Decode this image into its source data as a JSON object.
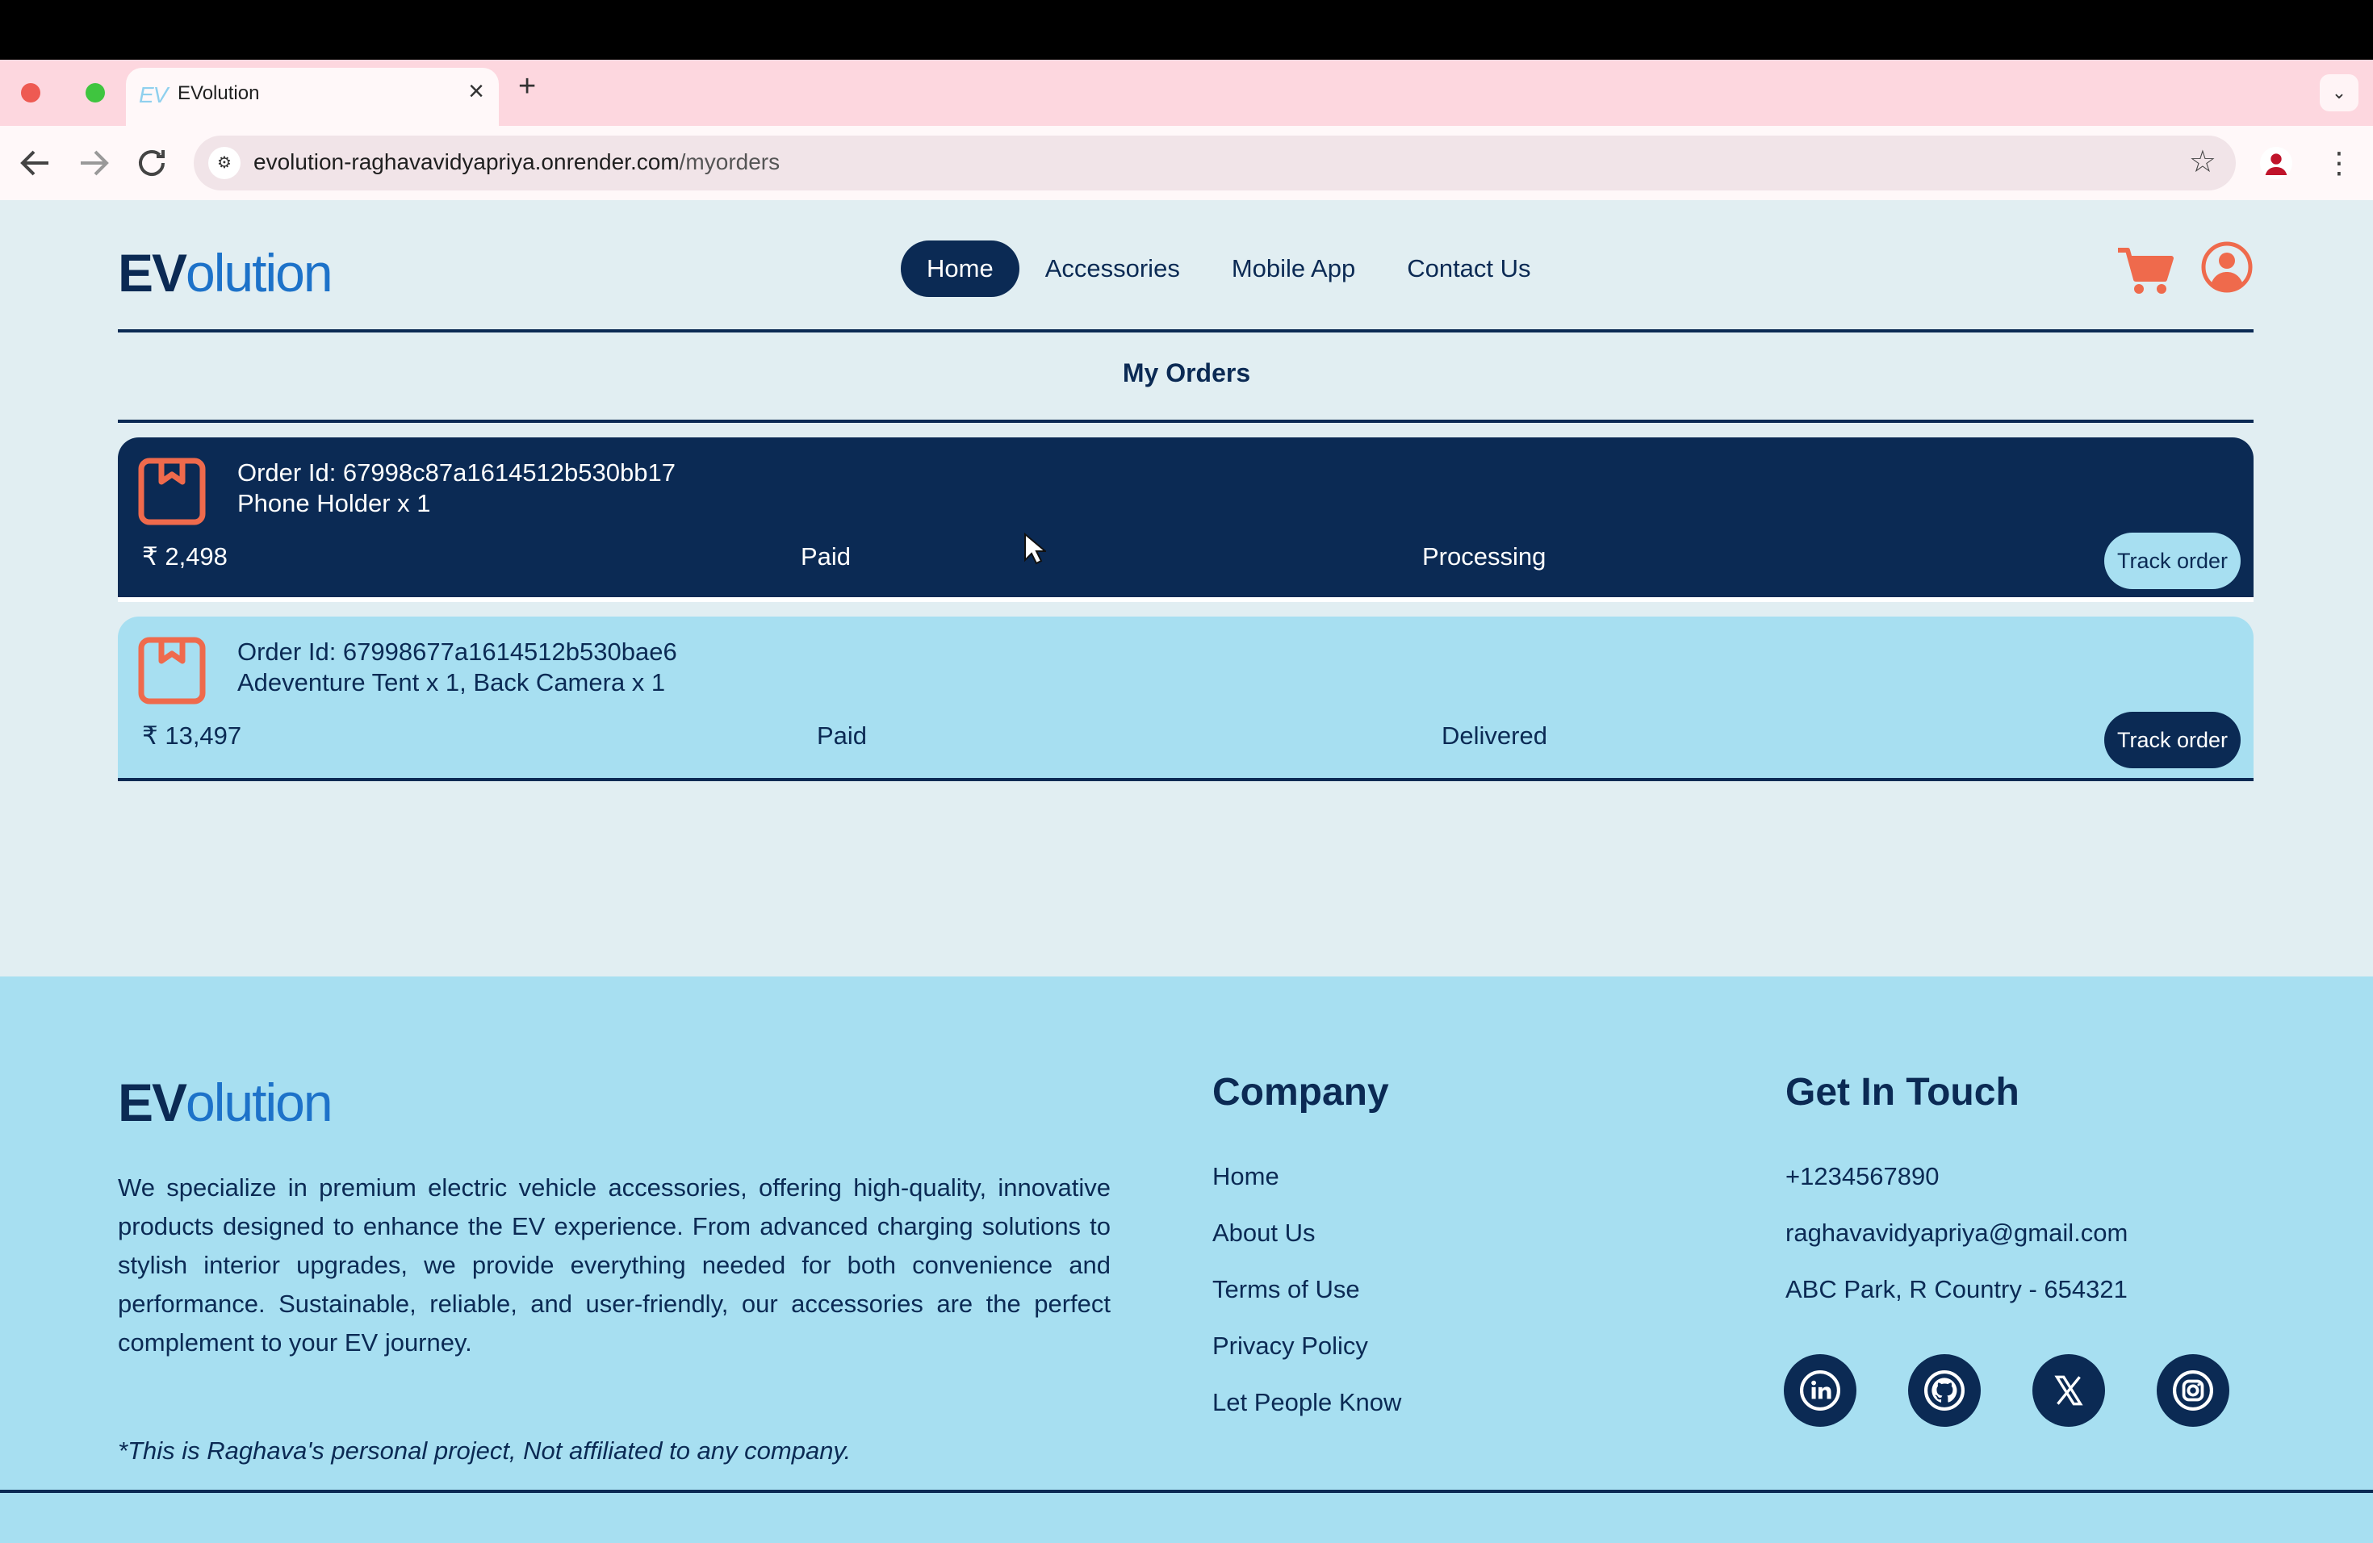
{
  "browser": {
    "tab_title": "EVolution",
    "favicon_text": "EV",
    "url_host": "evolution-raghavavidyapriya.onrender.com",
    "url_path": "/myorders"
  },
  "header": {
    "logo_bold": "EV",
    "logo_rest": "olution",
    "nav": [
      {
        "label": "Home",
        "active": true
      },
      {
        "label": "Accessories",
        "active": false
      },
      {
        "label": "Mobile App",
        "active": false
      },
      {
        "label": "Contact Us",
        "active": false
      }
    ]
  },
  "main": {
    "page_title": "My Orders",
    "orders": [
      {
        "order_id": "Order Id: 67998c87a1614512b530bb17",
        "items": "Phone Holder x 1",
        "amount": "₹ 2,498",
        "payment": "Paid",
        "status": "Processing",
        "track_label": "Track order"
      },
      {
        "order_id": "Order Id: 67998677a1614512b530bae6",
        "items": "Adeventure Tent x 1, Back Camera x 1",
        "amount": "₹ 13,497",
        "payment": "Paid",
        "status": "Delivered",
        "track_label": "Track order"
      }
    ]
  },
  "footer": {
    "logo_bold": "EV",
    "logo_rest": "olution",
    "about": "We specialize in premium electric vehicle accessories, offering high-quality, innovative products designed to enhance the EV experience. From advanced charging solutions to stylish interior upgrades, we provide everything needed for both convenience and performance. Sustainable, reliable, and user-friendly, our accessories are the perfect complement to your EV journey.",
    "disclaimer": "*This is Raghava's personal project, Not affiliated to any company.",
    "company_heading": "Company",
    "company_links": [
      "Home",
      "About Us",
      "Terms of Use",
      "Privacy Policy",
      "Let People Know"
    ],
    "contact_heading": "Get In Touch",
    "phone": "+1234567890",
    "email": "raghavavidyapriya@gmail.com",
    "address": "ABC Park, R Country - 654321",
    "social_icons": [
      "linkedin-icon",
      "github-icon",
      "x-icon",
      "instagram-icon"
    ]
  },
  "colors": {
    "navy": "#0b2a54",
    "accent": "#ef6a4c",
    "light_blue": "#a7dff1",
    "page_bg": "#e1eef2"
  }
}
